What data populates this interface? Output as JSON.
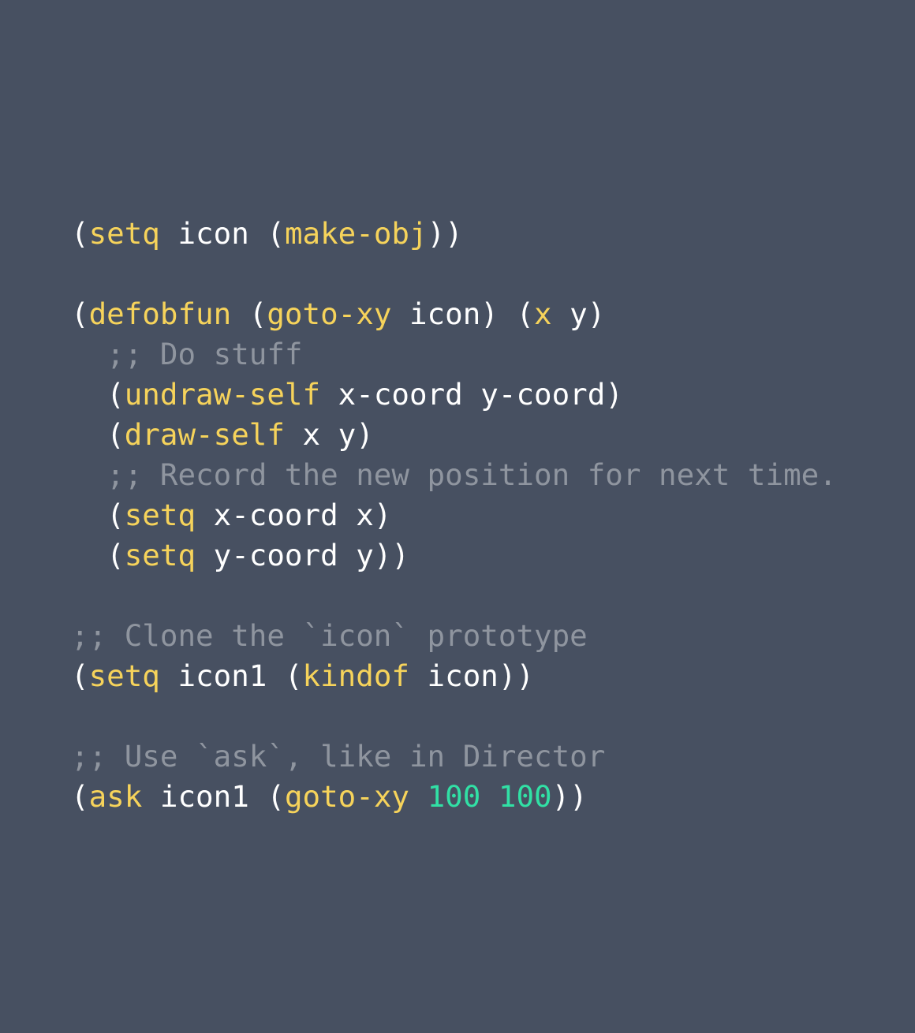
{
  "colors": {
    "background": "#475061",
    "plain": "#ffffff",
    "keyword": "#f6d35b",
    "number": "#31e0a5",
    "comment": "#8f959f"
  },
  "code_lines": [
    [
      {
        "text": "(",
        "type": "plain"
      },
      {
        "text": "setq",
        "type": "kw"
      },
      {
        "text": " icon (",
        "type": "plain"
      },
      {
        "text": "make-obj",
        "type": "kw"
      },
      {
        "text": "))",
        "type": "plain"
      }
    ],
    [],
    [
      {
        "text": "(",
        "type": "plain"
      },
      {
        "text": "defobfun",
        "type": "kw"
      },
      {
        "text": " (",
        "type": "plain"
      },
      {
        "text": "goto-xy",
        "type": "kw"
      },
      {
        "text": " icon) (",
        "type": "plain"
      },
      {
        "text": "x",
        "type": "kw"
      },
      {
        "text": " y)",
        "type": "plain"
      }
    ],
    [
      {
        "text": "  ;; Do stuff",
        "type": "comment"
      }
    ],
    [
      {
        "text": "  (",
        "type": "plain"
      },
      {
        "text": "undraw-self",
        "type": "kw"
      },
      {
        "text": " x-coord y-coord)",
        "type": "plain"
      }
    ],
    [
      {
        "text": "  (",
        "type": "plain"
      },
      {
        "text": "draw-self",
        "type": "kw"
      },
      {
        "text": " x y)",
        "type": "plain"
      }
    ],
    [
      {
        "text": "  ;; Record the new position for next time.",
        "type": "comment"
      }
    ],
    [
      {
        "text": "  (",
        "type": "plain"
      },
      {
        "text": "setq",
        "type": "kw"
      },
      {
        "text": " x-coord x)",
        "type": "plain"
      }
    ],
    [
      {
        "text": "  (",
        "type": "plain"
      },
      {
        "text": "setq",
        "type": "kw"
      },
      {
        "text": " y-coord y))",
        "type": "plain"
      }
    ],
    [],
    [
      {
        "text": ";; Clone the `icon` prototype",
        "type": "comment"
      }
    ],
    [
      {
        "text": "(",
        "type": "plain"
      },
      {
        "text": "setq",
        "type": "kw"
      },
      {
        "text": " icon1 (",
        "type": "plain"
      },
      {
        "text": "kindof",
        "type": "kw"
      },
      {
        "text": " icon))",
        "type": "plain"
      }
    ],
    [],
    [
      {
        "text": ";; Use `ask`, like in Director",
        "type": "comment"
      }
    ],
    [
      {
        "text": "(",
        "type": "plain"
      },
      {
        "text": "ask",
        "type": "kw"
      },
      {
        "text": " icon1 (",
        "type": "plain"
      },
      {
        "text": "goto-xy",
        "type": "kw"
      },
      {
        "text": " ",
        "type": "plain"
      },
      {
        "text": "100",
        "type": "num"
      },
      {
        "text": " ",
        "type": "plain"
      },
      {
        "text": "100",
        "type": "num"
      },
      {
        "text": "))",
        "type": "plain"
      }
    ]
  ]
}
